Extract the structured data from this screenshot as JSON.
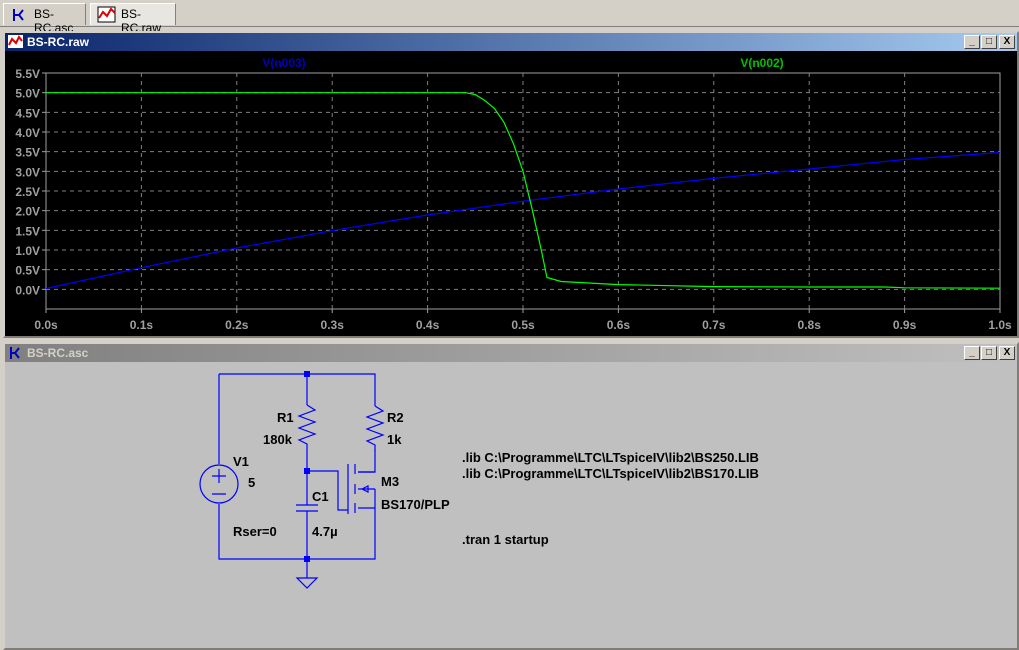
{
  "tabs": [
    {
      "label": "BS-RC.asc",
      "icon": "schematic-icon"
    },
    {
      "label": "BS-RC.raw",
      "icon": "waveform-icon"
    }
  ],
  "plot_window": {
    "title": "BS-RC.raw",
    "buttons": [
      "_",
      "□",
      "X"
    ]
  },
  "schematic_window": {
    "title": "BS-RC.asc",
    "buttons": [
      "_",
      "□",
      "X"
    ]
  },
  "chart_data": {
    "type": "line",
    "xlabel": "",
    "ylabel": "",
    "xlim": [
      0,
      1
    ],
    "ylim": [
      -0.5,
      5.5
    ],
    "x_ticks": [
      "0.0s",
      "0.1s",
      "0.2s",
      "0.3s",
      "0.4s",
      "0.5s",
      "0.6s",
      "0.7s",
      "0.8s",
      "0.9s",
      "1.0s"
    ],
    "y_ticks": [
      "5.5V",
      "5.0V",
      "4.5V",
      "4.0V",
      "3.5V",
      "3.0V",
      "2.5V",
      "2.0V",
      "1.5V",
      "1.0V",
      "0.5V",
      "0.0V"
    ],
    "grid": true,
    "series": [
      {
        "name": "V(n003)",
        "color": "#0000ff",
        "x": [
          0,
          0.1,
          0.2,
          0.3,
          0.4,
          0.5,
          0.6,
          0.7,
          0.8,
          0.9,
          1.0
        ],
        "y": [
          0.02,
          0.55,
          1.05,
          1.49,
          1.89,
          2.24,
          2.55,
          2.82,
          3.06,
          3.3,
          3.48
        ]
      },
      {
        "name": "V(n002)",
        "color": "#00ff00",
        "x": [
          0,
          0.43,
          0.44,
          0.45,
          0.46,
          0.47,
          0.48,
          0.49,
          0.5,
          0.51,
          0.52,
          0.525,
          0.54,
          0.6,
          0.7,
          0.8,
          0.88,
          0.9,
          1.0
        ],
        "y": [
          5.0,
          5.0,
          5.0,
          4.95,
          4.8,
          4.6,
          4.25,
          3.7,
          3.0,
          2.0,
          0.9,
          0.3,
          0.2,
          0.12,
          0.07,
          0.06,
          0.06,
          0.04,
          0.03
        ]
      }
    ]
  },
  "schematic": {
    "components": [
      {
        "ref": "V1",
        "value": "5",
        "extra": "Rser=0"
      },
      {
        "ref": "R1",
        "value": "180k"
      },
      {
        "ref": "R2",
        "value": "1k"
      },
      {
        "ref": "C1",
        "value": "4.7µ"
      },
      {
        "ref": "M3",
        "value": "BS170/PLP"
      }
    ],
    "directives": [
      ".lib C:\\Programme\\LTC\\LTspiceIV\\lib2\\BS250.LIB",
      ".lib C:\\Programme\\LTC\\LTspiceIV\\lib2\\BS170.LIB",
      ".tran 1 startup"
    ]
  }
}
